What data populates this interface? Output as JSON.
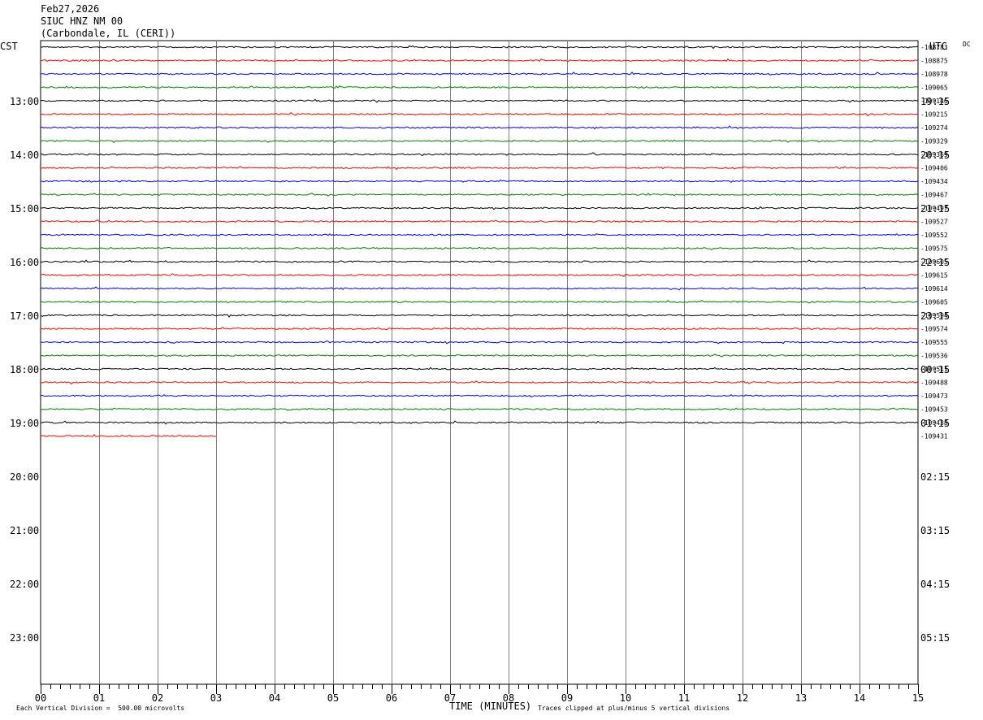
{
  "header": {
    "date": "Feb27,2026",
    "station": "SIUC HNZ NM 00",
    "location": "(Carbondale, IL (CERI))"
  },
  "chart_data": {
    "type": "line",
    "title": "",
    "left_axis_label": "CST",
    "right_axis_label": "UTC",
    "dc_label": "DC",
    "xlabel": "TIME (MINUTES)",
    "xlim": [
      0,
      15
    ],
    "x_ticks": [
      "00",
      "01",
      "02",
      "03",
      "04",
      "05",
      "06",
      "07",
      "08",
      "09",
      "10",
      "11",
      "12",
      "13",
      "14",
      "15"
    ],
    "hour_labels_cst": [
      "13:00",
      "14:00",
      "15:00",
      "16:00",
      "17:00",
      "18:00",
      "19:00",
      "20:00",
      "21:00",
      "22:00",
      "23:00"
    ],
    "hour_labels_utc": [
      "19:15",
      "20:15",
      "21:15",
      "22:15",
      "23:15",
      "00:15",
      "01:15",
      "02:15",
      "03:15",
      "04:15",
      "05:15"
    ],
    "trace_colors": [
      "#000000",
      "#ff0000",
      "#0000ff",
      "#008000"
    ],
    "rows_per_hour": 4,
    "first_row_index": 0,
    "grid": true,
    "traces": [
      {
        "dc": "-108783",
        "end_minute": 15
      },
      {
        "dc": "-108875",
        "end_minute": 15
      },
      {
        "dc": "-108978",
        "end_minute": 15
      },
      {
        "dc": "-109065",
        "end_minute": 15
      },
      {
        "dc": "-109146",
        "end_minute": 15
      },
      {
        "dc": "-109215",
        "end_minute": 15
      },
      {
        "dc": "-109274",
        "end_minute": 15
      },
      {
        "dc": "-109329",
        "end_minute": 15
      },
      {
        "dc": "-109369",
        "end_minute": 15
      },
      {
        "dc": "-109406",
        "end_minute": 15
      },
      {
        "dc": "-109434",
        "end_minute": 15
      },
      {
        "dc": "-109467",
        "end_minute": 15
      },
      {
        "dc": "-109497",
        "end_minute": 15
      },
      {
        "dc": "-109527",
        "end_minute": 15
      },
      {
        "dc": "-109552",
        "end_minute": 15
      },
      {
        "dc": "-109575",
        "end_minute": 15
      },
      {
        "dc": "-109605",
        "end_minute": 15
      },
      {
        "dc": "-109615",
        "end_minute": 15
      },
      {
        "dc": "-109614",
        "end_minute": 15
      },
      {
        "dc": "-109605",
        "end_minute": 15
      },
      {
        "dc": "-109594",
        "end_minute": 15
      },
      {
        "dc": "-109574",
        "end_minute": 15
      },
      {
        "dc": "-109555",
        "end_minute": 15
      },
      {
        "dc": "-109536",
        "end_minute": 15
      },
      {
        "dc": "-109511",
        "end_minute": 15
      },
      {
        "dc": "-109488",
        "end_minute": 15
      },
      {
        "dc": "-109473",
        "end_minute": 15
      },
      {
        "dc": "-109453",
        "end_minute": 15
      },
      {
        "dc": "-109438",
        "end_minute": 15
      },
      {
        "dc": "-109431",
        "end_minute": 3
      }
    ]
  },
  "footer": {
    "scale_note": "Each Vertical Division =  500.00 microvolts",
    "clip_note": "Traces clipped at plus/minus 5 vertical divisions"
  }
}
